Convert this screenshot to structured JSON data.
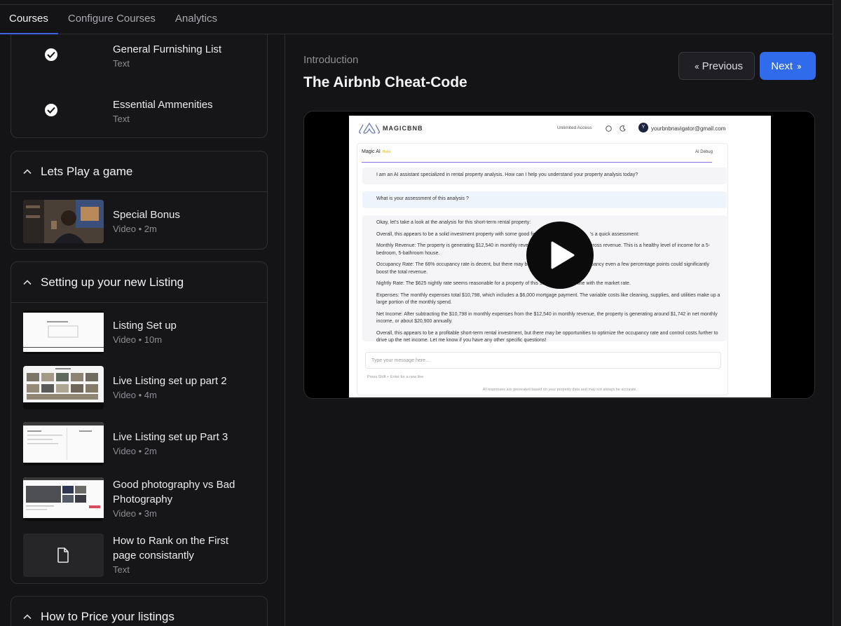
{
  "tabs": [
    {
      "label": "Courses",
      "active": true
    },
    {
      "label": "Configure Courses",
      "active": false
    },
    {
      "label": "Analytics",
      "active": false
    }
  ],
  "sidebar": {
    "top_items": [
      {
        "title": "General Furnishing List",
        "meta": "Text",
        "completed": true
      },
      {
        "title": "Essential Ammenities",
        "meta": "Text",
        "completed": true
      }
    ],
    "sections": [
      {
        "title": "Lets Play a game",
        "lessons": [
          {
            "title": "Special Bonus",
            "meta": "Video • 2m"
          }
        ]
      },
      {
        "title": "Setting up your new Listing",
        "lessons": [
          {
            "title": "Listing Set up",
            "meta": "Video • 10m"
          },
          {
            "title": "Live Listing set up part 2",
            "meta": "Video • 4m"
          },
          {
            "title": "Live Listing set up Part 3",
            "meta": "Video • 2m"
          },
          {
            "title": "Good photography vs Bad Photography",
            "meta": "Video • 3m"
          },
          {
            "title": "How to Rank on the First page consistantly",
            "meta": "Text"
          }
        ]
      },
      {
        "title": "How to Price your listings",
        "lessons": []
      }
    ]
  },
  "main": {
    "eyebrow": "Introduction",
    "title": "The Airbnb Cheat-Code",
    "prev_label": "Previous",
    "next_label": "Next"
  },
  "video_frame": {
    "brand": "MAGICBNB",
    "unlimited": "Unlimited Access",
    "avatar_letter": "Y",
    "email": "yourbnbnavigator@gmail.com",
    "panel_title": "Magic AI",
    "panel_badge": "Beta",
    "debug_label": "AI Debug",
    "assistant_intro": "I am an AI assistant specialized in rental property analysis. How can I help you understand your property analysis today?",
    "user_question": "What is your assessment of this analysis ?",
    "answer_lines": [
      "Okay, let's take a look at the analysis for this short-term rental property:",
      "Overall, this appears to be a solid investment property with some good financ",
      "Monthly Revenue: The property is generating $12,540 in monthly revenue, w",
      "bedroom, 5-bathroom house.",
      "Occupancy Rate: The 66% occupancy rate is decent, but there may be roo",
      "boost the total revenue.",
      "Nightly Rate: The $625 nightly rate seems reasonable for a property of this size a",
      "Expenses: The monthly expenses total $10,798, which includes a $6,000 mortgage payment. The variable costs like cleaning, supplies, and utilities make up a large portion of the monthly spend.",
      "Net Income: After subtracting the $10,798 in monthly expenses from the $12,540 in monthly revenue, the property is generating around $1,742 in net monthly income, or about $20,900 annually.",
      "Overall, this appears to be a profitable short-term rental investment, but there may be opportunities to optimize the occupancy rate and control costs further to drive up the net income. Let me know if you have any other specific questions!"
    ],
    "answer_tail_1": "'s a quick assessment:",
    "answer_tail_2": "al gross revenue. This is a healthy level of income for a 5-",
    "answer_tail_3": "occupancy even a few percentage points could significantly",
    "answer_tail_4": "in line with the market rate.",
    "input_placeholder": "Type your message here...",
    "hint": "Press Shift + Enter for a new line",
    "footer": "AI responses are generated based on your property data and may not always be accurate."
  },
  "colors": {
    "accent": "#2f6bea",
    "background": "#141416"
  }
}
